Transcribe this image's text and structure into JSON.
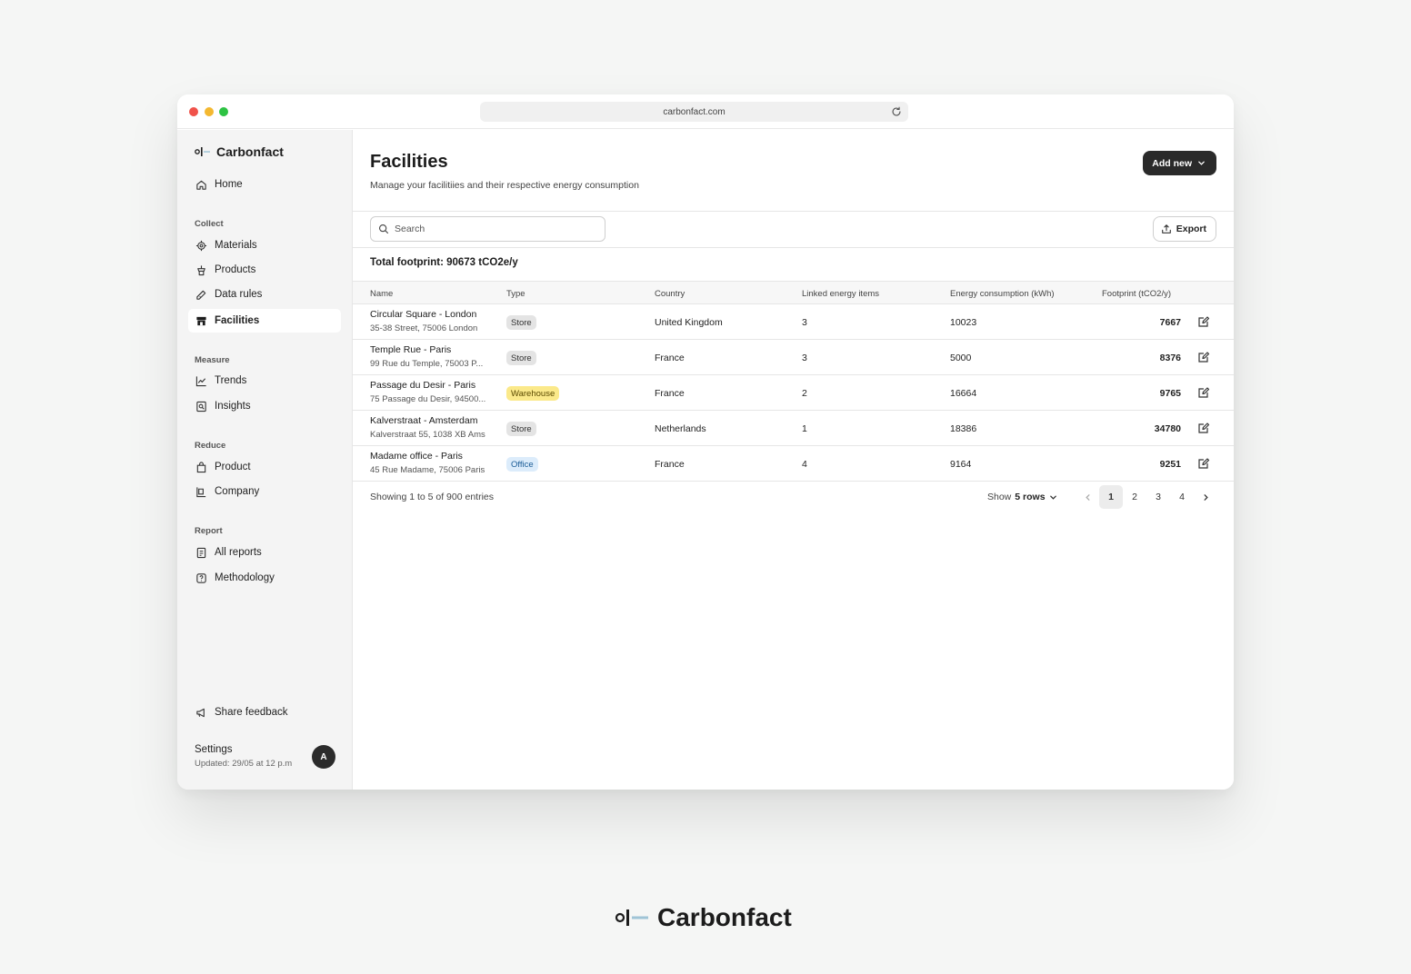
{
  "browser": {
    "url": "carbonfact.com"
  },
  "brand": {
    "name": "Carbonfact"
  },
  "sidebar": {
    "home": {
      "label": "Home",
      "icon": "home-icon"
    },
    "sections": [
      {
        "title": "Collect",
        "items": [
          {
            "label": "Materials",
            "icon": "cog-icon"
          },
          {
            "label": "Products",
            "icon": "product-icon"
          },
          {
            "label": "Data rules",
            "icon": "tag-icon"
          },
          {
            "label": "Facilities",
            "icon": "store-icon",
            "active": true
          }
        ]
      },
      {
        "title": "Measure",
        "items": [
          {
            "label": "Trends",
            "icon": "trend-icon"
          },
          {
            "label": "Insights",
            "icon": "insights-icon"
          }
        ]
      },
      {
        "title": "Reduce",
        "items": [
          {
            "label": "Product",
            "icon": "bag-icon"
          },
          {
            "label": "Company",
            "icon": "company-icon"
          }
        ]
      },
      {
        "title": "Report",
        "items": [
          {
            "label": "All reports",
            "icon": "report-icon"
          },
          {
            "label": "Methodology",
            "icon": "help-icon"
          }
        ]
      }
    ],
    "feedback": {
      "label": "Share feedback",
      "icon": "megaphone-icon"
    },
    "settings": {
      "label": "Settings",
      "updated": "Updated: 29/05 at 12 p.m"
    },
    "avatar": "A"
  },
  "header": {
    "title": "Facilities",
    "subtitle": "Manage your facilitiies and their respective energy consumption",
    "add_button": "Add new"
  },
  "toolbar": {
    "search_placeholder": "Search",
    "export_label": "Export"
  },
  "summary": {
    "total": "Total footprint: 90673 tCO2e/y"
  },
  "table": {
    "columns": [
      "Name",
      "Type",
      "Country",
      "Linked energy items",
      "Energy consumption (kWh)",
      "Footprint (tCO2/y)"
    ],
    "rows": [
      {
        "name": "Circular Square - London",
        "address": "35-38 Street, 75006 London",
        "type": "Store",
        "country": "United Kingdom",
        "linked": "3",
        "energy": "10023",
        "footprint": "7667"
      },
      {
        "name": "Temple Rue - Paris",
        "address": "99 Rue du Temple, 75003 P...",
        "type": "Store",
        "country": "France",
        "linked": "3",
        "energy": "5000",
        "footprint": "8376"
      },
      {
        "name": "Passage du Desir - Paris",
        "address": "75 Passage du Desir, 94500...",
        "type": "Warehouse",
        "country": "France",
        "linked": "2",
        "energy": "16664",
        "footprint": "9765"
      },
      {
        "name": "Kalverstraat - Amsterdam",
        "address": "Kalverstraat 55, 1038 XB Ams",
        "type": "Store",
        "country": "Netherlands",
        "linked": "1",
        "energy": "18386",
        "footprint": "34780"
      },
      {
        "name": "Madame office - Paris",
        "address": "45 Rue Madame, 75006 Paris",
        "type": "Office",
        "country": "France",
        "linked": "4",
        "energy": "9164",
        "footprint": "9251"
      }
    ]
  },
  "pagination": {
    "info": "Showing 1 to 5 of 900 entries",
    "show_label": "Show",
    "rows_value": "5 rows",
    "pages": [
      "1",
      "2",
      "3",
      "4"
    ],
    "current": "1"
  },
  "footer_brand": "Carbonfact"
}
